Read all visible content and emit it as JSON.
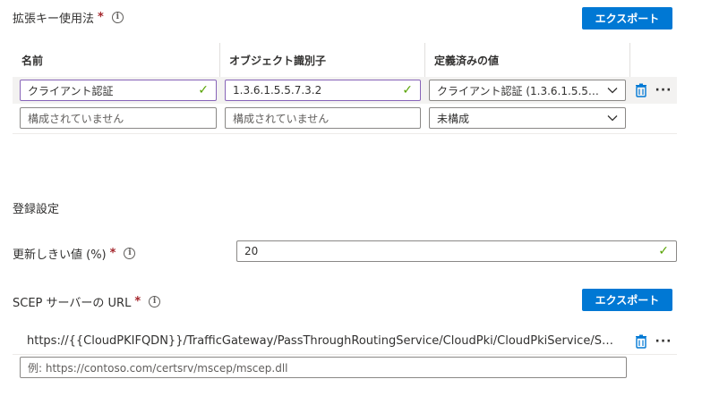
{
  "extended_key_usage": {
    "label": "拡張キー使用法",
    "required_mark": "*",
    "export_label": "エクスポート",
    "columns": [
      "名前",
      "オブジェクト識別子",
      "定義済みの値"
    ],
    "rows": [
      {
        "name": "クライアント認証",
        "oid": "1.3.6.1.5.5.7.3.2",
        "predefined": "クライアント認証 (1.3.6.1.5.5.…"
      },
      {
        "name_placeholder": "構成されていません",
        "oid_placeholder": "構成されていません",
        "predefined": "未構成"
      }
    ]
  },
  "enrollment": {
    "heading": "登録設定",
    "renewal_label": "更新しきい値 (%)",
    "required_mark": "*",
    "renewal_value": "20"
  },
  "scep": {
    "label": "SCEP サーバーの URL",
    "required_mark": "*",
    "export_label": "エクスポート",
    "url_value": "https://{{CloudPKIFQDN}}/TrafficGateway/PassThroughRoutingService/CloudPki/CloudPkiService/Sc…",
    "placeholder": "例: https://contoso.com/certsrv/mscep/mscep.dll"
  },
  "icons": {
    "info": "info-icon",
    "check": "checkmark-icon",
    "chevron": "chevron-down-icon",
    "trash": "trash-icon",
    "more": "more-icon"
  },
  "colors": {
    "accent": "#0078d4",
    "valid": "#57a300",
    "required": "#a4262c",
    "active_border": "#8764b8"
  }
}
